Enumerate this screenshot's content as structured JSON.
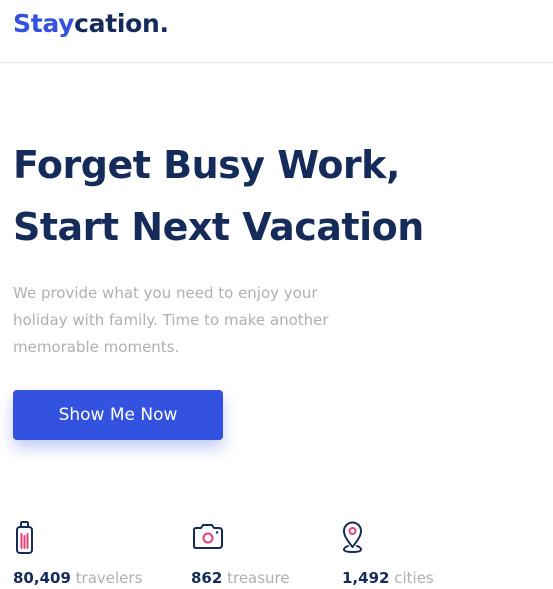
{
  "header": {
    "logo_part_1": "Stay",
    "logo_part_2": "cation."
  },
  "hero": {
    "title_line_1": "Forget Busy Work,",
    "title_line_2": "Start Next Vacation",
    "description": "We provide what you need to enjoy your holiday with family. Time to make another memorable moments.",
    "cta_label": "Show Me Now"
  },
  "stats": [
    {
      "icon": "suitcase-icon",
      "value": "80,409",
      "label": "travelers"
    },
    {
      "icon": "camera-icon",
      "value": "862",
      "label": "treasure"
    },
    {
      "icon": "map-pin-icon",
      "value": "1,492",
      "label": "cities"
    }
  ],
  "colors": {
    "primary": "#3252DF",
    "navy": "#152C5B",
    "muted": "#B0B0B0",
    "accent_pink": "#E33F7A"
  }
}
